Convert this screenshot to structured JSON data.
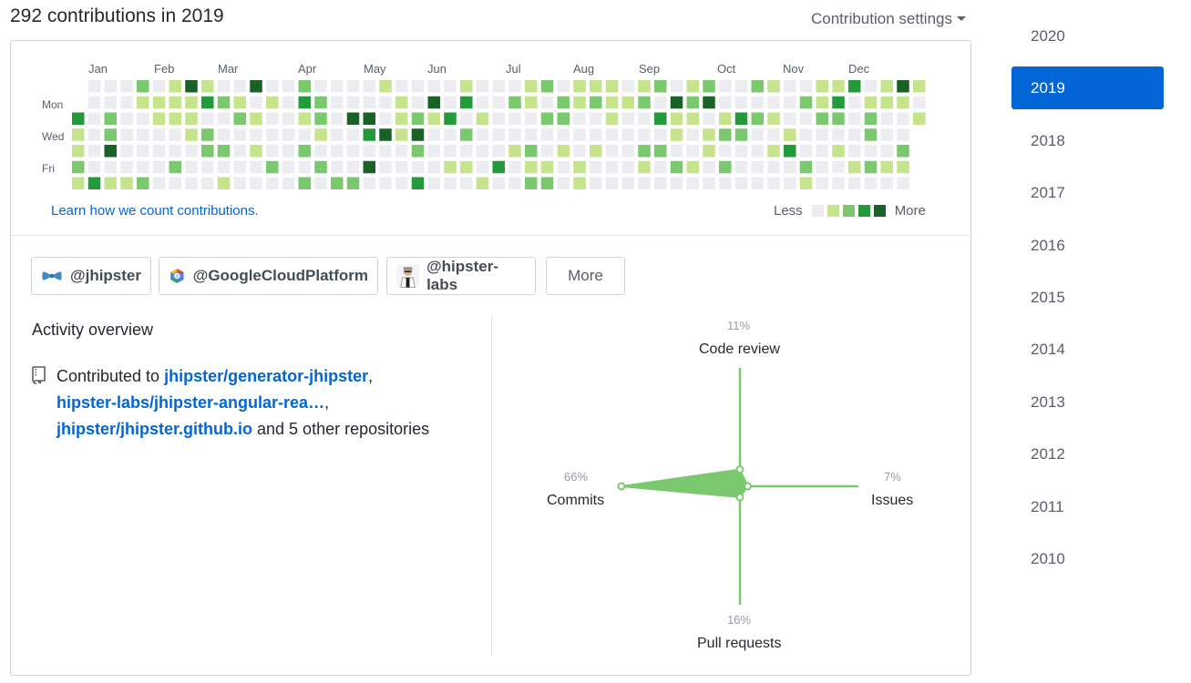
{
  "header": {
    "title": "292 contributions in 2019",
    "settings_label": "Contribution settings"
  },
  "calendar": {
    "months": [
      "Jan",
      "Feb",
      "Mar",
      "Apr",
      "May",
      "Jun",
      "Jul",
      "Aug",
      "Sep",
      "Oct",
      "Nov",
      "Dec"
    ],
    "day_labels": [
      "Mon",
      "Wed",
      "Fri"
    ],
    "levels_colors": [
      "#ebedf0",
      "#c6e48b",
      "#7bc96f",
      "#239a3b",
      "#196127"
    ],
    "learn_link": "Learn how we count contributions.",
    "legend_less": "Less",
    "legend_more": "More"
  },
  "orgs": [
    {
      "label": "@jhipster",
      "icon": "jhipster-bowtie-icon"
    },
    {
      "label": "@GoogleCloudPlatform",
      "icon": "google-cloud-icon"
    },
    {
      "label": "@hipster-labs",
      "icon": "hipster-labs-avatar-icon"
    }
  ],
  "more_button": "More",
  "activity": {
    "title": "Activity overview",
    "prefix": "Contributed to ",
    "repos": [
      "jhipster/generator-jhipster",
      "hipster-labs/jhipster-angular-rea…",
      "jhipster/jhipster.github.io"
    ],
    "suffix": " and 5 other repositories"
  },
  "radar": {
    "code_review": {
      "label": "Code review",
      "percent": "11%"
    },
    "issues": {
      "label": "Issues",
      "percent": "7%"
    },
    "pull_requests": {
      "label": "Pull requests",
      "percent": "16%"
    },
    "commits": {
      "label": "Commits",
      "percent": "66%"
    },
    "color": "#7bc96f"
  },
  "years": [
    "2020",
    "2019",
    "2018",
    "2017",
    "2016",
    "2015",
    "2014",
    "2013",
    "2012",
    "2011",
    "2010"
  ],
  "selected_year": "2019"
}
